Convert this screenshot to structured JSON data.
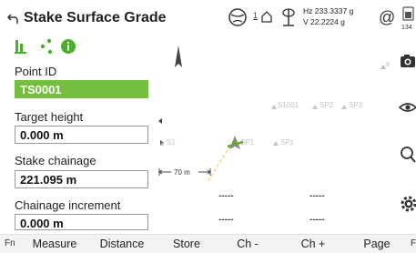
{
  "header": {
    "title": "Stake Surface Grade",
    "rtk_value": "1",
    "hz": "Hz 233.3337 g",
    "v": "V  22.2224 g",
    "battery_level": "134"
  },
  "panel": {
    "point_id": {
      "label": "Point ID",
      "value": "TS0001"
    },
    "target_height": {
      "label": "Target height",
      "value": "0.000 m"
    },
    "stake_chainage": {
      "label": "Stake chainage",
      "value": "221.095 m"
    },
    "chainage_increment": {
      "label": "Chainage increment",
      "value": "0.000 m"
    }
  },
  "map": {
    "labels": {
      "s1001": "S1001",
      "sp2": "SP2",
      "sp3": "SP3",
      "sp1": "SP1",
      "sp1b": "SP1",
      "s1": "S1"
    },
    "scale": "70 m",
    "dashes": [
      "-----",
      "-----",
      "-----",
      "-----"
    ]
  },
  "bottom": {
    "fn": "Fn",
    "softkeys": [
      "Measure",
      "Distance",
      "Store",
      "Ch -",
      "Ch +",
      "Page"
    ],
    "f_edge": "F"
  }
}
